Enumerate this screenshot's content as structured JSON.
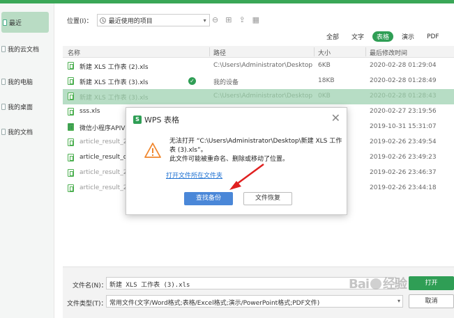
{
  "sidebar": {
    "items": [
      {
        "label": "最近",
        "active": true
      },
      {
        "label": "我的云文档"
      },
      {
        "label": "我的电脑"
      },
      {
        "label": "我的桌面"
      },
      {
        "label": "我的文档"
      }
    ]
  },
  "location": {
    "label": "位置(I)：",
    "value": "最近使用的项目"
  },
  "filter_tabs": [
    "全部",
    "文字",
    "表格",
    "演示",
    "PDF"
  ],
  "filter_active": "表格",
  "table": {
    "headers": {
      "name": "名称",
      "path": "路径",
      "size": "大小",
      "date": "最后修改时间"
    },
    "rows": [
      {
        "name": "新建 XLS 工作表 (2).xls",
        "path": "C:\\Users\\Administrator\\Desktop",
        "size": "6KB",
        "date": "2020-02-28 01:29:04"
      },
      {
        "name": "新建 XLS 工作表 (3).xls",
        "path": "我的设备",
        "size": "18KB",
        "date": "2020-02-28 01:28:49"
      },
      {
        "name": "新建 XLS 工作表 (3).xls",
        "path": "C:\\Users\\Administrator\\Desktop",
        "size": "0KB",
        "date": "2020-02-28 01:28:43"
      },
      {
        "name": "sss.xls",
        "path": "",
        "size": "",
        "date": "2020-02-27 23:19:56"
      },
      {
        "name": "微信小程序APIV",
        "path": "",
        "size": "",
        "date": "2019-10-31 15:31:07"
      },
      {
        "name": "article_result_20",
        "path": "",
        "size": "",
        "date": "2019-02-26 23:49:54"
      },
      {
        "name": "article_result_de",
        "path": "",
        "size": "",
        "date": "2019-02-26 23:49:23"
      },
      {
        "name": "article_result_20",
        "path": "",
        "size": "",
        "date": "2019-02-26 23:46:37"
      },
      {
        "name": "article_result_20",
        "path": "",
        "size": "",
        "date": "2019-02-26 23:44:18"
      }
    ]
  },
  "bottom": {
    "filename_label": "文件名(N)：",
    "filename_value": "新建 XLS 工作表 (3).xls",
    "filetype_label": "文件类型(T)：",
    "filetype_value": "常用文件(文字/Word格式;表格/Excel格式;演示/PowerPoint格式;PDF文件)",
    "open_label": "打开",
    "cancel_label": "取消"
  },
  "dialog": {
    "app_icon": "S",
    "title": "WPS 表格",
    "message_line1": "无法打开 “C:\\Users\\Administrator\\Desktop\\新建 XLS 工作表 (3).xls”。",
    "message_line2": "此文件可能被重命名、删除或移动了位置。",
    "link": "打开文件所在文件夹",
    "primary_button": "查找备份",
    "secondary_button": "文件恢复"
  },
  "watermark": {
    "text_left": "Bai",
    "text_right": "经验"
  },
  "colors": {
    "brand_green": "#2f9e55",
    "dialog_blue": "#4a87d8",
    "warning_orange": "#f0862d",
    "arrow_red": "#e02020"
  }
}
